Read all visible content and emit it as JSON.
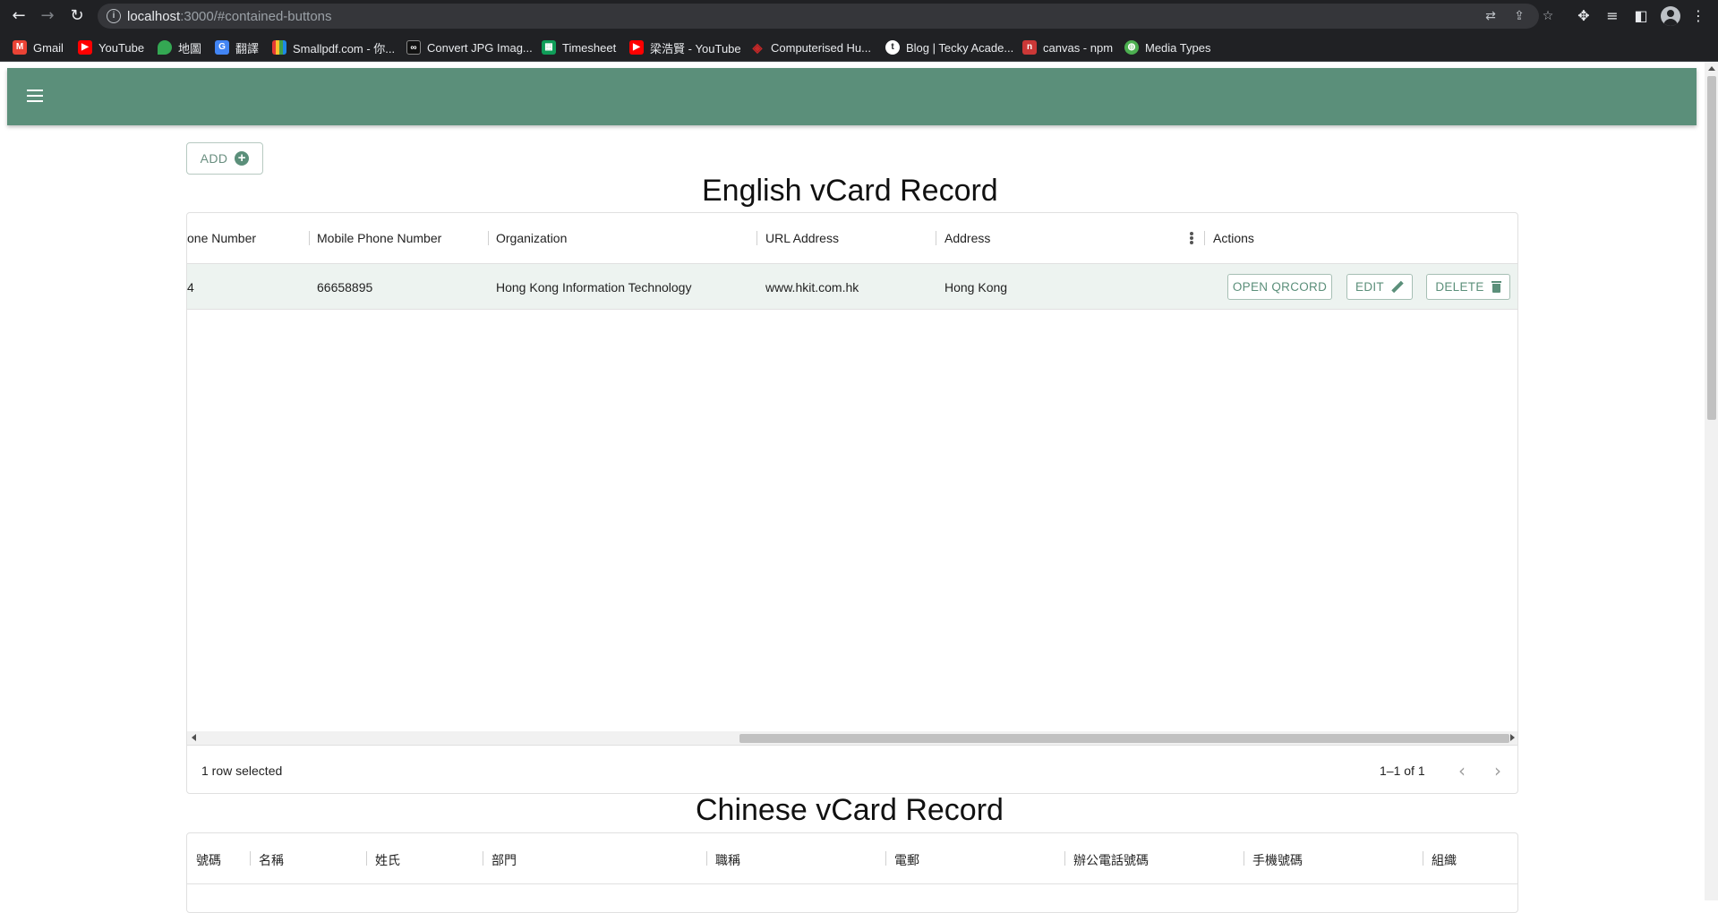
{
  "browser": {
    "url_host": "localhost",
    "url_rest": ":3000/#contained-buttons",
    "bookmarks": [
      {
        "label": "Gmail",
        "icon": "gmail-icon",
        "color": "#ea4335"
      },
      {
        "label": "YouTube",
        "icon": "youtube-icon",
        "color": "#ff0000"
      },
      {
        "label": "地圖",
        "icon": "maps-icon",
        "color": "#34a853"
      },
      {
        "label": "翻譯",
        "icon": "translate-icon",
        "color": "#4285f4"
      },
      {
        "label": "Smallpdf.com - 你...",
        "icon": "smallpdf-icon",
        "color": "#e53935"
      },
      {
        "label": "Convert JPG Imag...",
        "icon": "convert-icon",
        "color": "#111111"
      },
      {
        "label": "Timesheet",
        "icon": "sheet-icon",
        "color": "#0f9d58"
      },
      {
        "label": "梁浩賢 - YouTube",
        "icon": "youtube-icon",
        "color": "#ff0000"
      },
      {
        "label": "Computerised Hu...",
        "icon": "diamond-icon",
        "color": "#c62828"
      },
      {
        "label": "Blog | Tecky Acade...",
        "icon": "tecky-icon",
        "color": "#ffffff"
      },
      {
        "label": "canvas - npm",
        "icon": "npm-icon",
        "color": "#cb3837"
      },
      {
        "label": "Media Types",
        "icon": "globe-icon",
        "color": "#4caf50"
      }
    ]
  },
  "app": {
    "accent": "#5b8f7a",
    "add_label": "ADD",
    "english_title": "English vCard Record",
    "chinese_title": "Chinese vCard Record",
    "english_table": {
      "columns": {
        "phone": "one Number",
        "mobile": "Mobile Phone Number",
        "organization": "Organization",
        "url": "URL Address",
        "address": "Address",
        "actions": "Actions"
      },
      "row": {
        "phone": "4",
        "mobile": "66658895",
        "organization": "Hong Kong Information Technology",
        "url": "www.hkit.com.hk",
        "address": "Hong Kong"
      },
      "buttons": {
        "qr": "OPEN QRCORD",
        "edit": "EDIT",
        "delete": "DELETE"
      },
      "footer": {
        "selected": "1 row selected",
        "pagination": "1–1 of 1"
      }
    },
    "chinese_table": {
      "columns": [
        "號碼",
        "名稱",
        "姓氏",
        "部門",
        "職稱",
        "電郵",
        "辦公電話號碼",
        "手機號碼",
        "組織"
      ]
    }
  }
}
